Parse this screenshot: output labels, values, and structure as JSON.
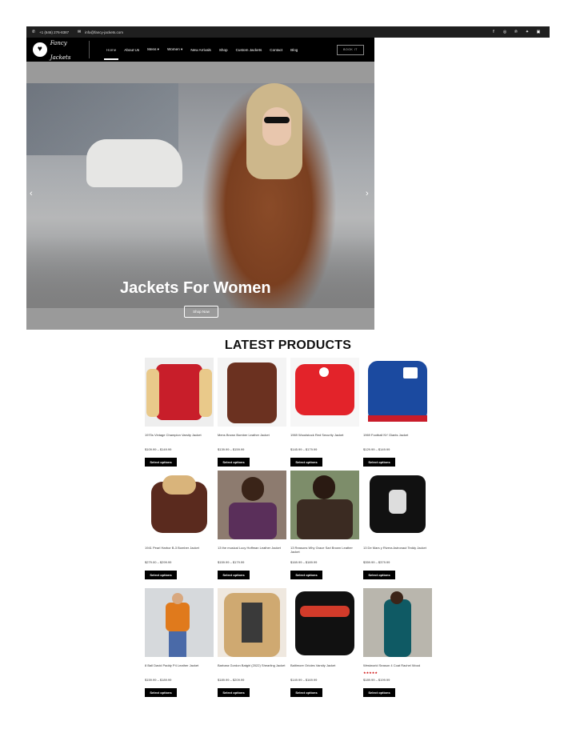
{
  "topbar": {
    "phone": "+1 (646) 276-8387",
    "email": "info@fancy-jackets.com",
    "social_icons": [
      "facebook-icon",
      "instagram-icon",
      "pinterest-icon",
      "twitter-icon",
      "linkedin-icon"
    ]
  },
  "nav": {
    "logo_text": "Fancy Jackets",
    "logo_tagline": "FOR THE LOVE OF FASHION",
    "menu": [
      "Home",
      "About Us",
      "Mens ▾",
      "Women ▾",
      "New Arrivals",
      "Shop",
      "Custom Jackets",
      "Contact",
      "Blog"
    ],
    "active_index": 0,
    "book_label": "BOOK IT"
  },
  "hero": {
    "title": "Jackets For Women",
    "button": "Shop Now",
    "prev_icon": "‹",
    "next_icon": "›"
  },
  "section_title": "LATEST PRODUCTS",
  "products": [
    {
      "name": "1970s Vintage Champion Varsity Jacket",
      "price": "$109.99 – $149.99",
      "button": "Select options",
      "stars": ""
    },
    {
      "name": "Mens Brown Bomber Leather Jacket",
      "price": "$139.99 – $159.99",
      "button": "Select options",
      "stars": ""
    },
    {
      "name": "1969 Woodstock Red Security Jacket",
      "price": "$145.99 – $179.99",
      "button": "Select options",
      "stars": ""
    },
    {
      "name": "1969 Football NY Giants Jacket",
      "price": "$129.99 – $149.99",
      "button": "Select options",
      "stars": ""
    },
    {
      "name": "1941 Pearl Harbor B-3 Bomber Jacket",
      "price": "$279.00 – $299.99",
      "button": "Select options",
      "stars": ""
    },
    {
      "name": "13 the musical Lucy Hoffman Leather Jacket",
      "price": "$159.99 – $179.99",
      "button": "Select options",
      "stars": ""
    },
    {
      "name": "13 Reasons Why Grace Sari Brown Leather Jacket",
      "price": "$169.99 – $189.99",
      "button": "Select options",
      "stars": ""
    },
    {
      "name": "13 De Mars y Rivera Astronaut Teddy Jacket",
      "price": "$359.99 – $379.99",
      "button": "Select options",
      "stars": ""
    },
    {
      "name": "8 Ball David Paddy P4 Leather Jacket",
      "price": "$159.99 – $189.99",
      "button": "Select options",
      "stars": ""
    },
    {
      "name": "Barbara Gordon Batgirl (2022) Shearling Jacket",
      "price": "$189.99 – $209.99",
      "button": "Select options",
      "stars": ""
    },
    {
      "name": "Baltimore Orioles Varsity Jacket",
      "price": "$149.99 – $169.99",
      "button": "Select options",
      "stars": ""
    },
    {
      "name": "Westworld Season 4 Coat Rachel Wood",
      "price": "$189.99 – $199.99",
      "button": "Select options",
      "stars": "★★★★★"
    }
  ],
  "colors": {
    "accent": "#000000",
    "rating": "#c00000",
    "topbar": "#1f1f1f"
  }
}
